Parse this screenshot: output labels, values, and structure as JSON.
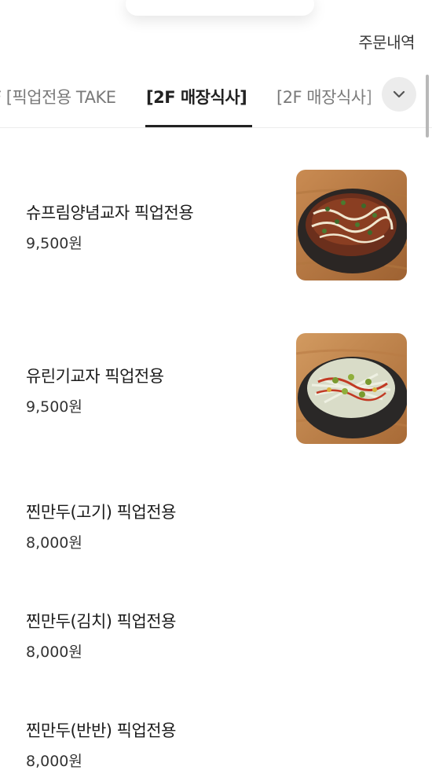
{
  "header": {
    "order_history_label": "주문내역"
  },
  "tabs": [
    {
      "label": "F [픽업전용 TAKE"
    },
    {
      "label": "[2F 매장식사]"
    },
    {
      "label": "[2F 매장식사]"
    }
  ],
  "icons": {
    "expand": "chevron-down-icon"
  },
  "menu": [
    {
      "name": "슈프림양념교자 픽업전용",
      "price": "9,500원",
      "has_image": true
    },
    {
      "name": "유린기교자 픽업전용",
      "price": "9,500원",
      "has_image": true
    },
    {
      "name": "찐만두(고기) 픽업전용",
      "price": "8,000원",
      "has_image": false
    },
    {
      "name": "찐만두(김치) 픽업전용",
      "price": "8,000원",
      "has_image": false
    },
    {
      "name": "찐만두(반반) 픽업전용",
      "price": "8,000원",
      "has_image": false
    }
  ]
}
